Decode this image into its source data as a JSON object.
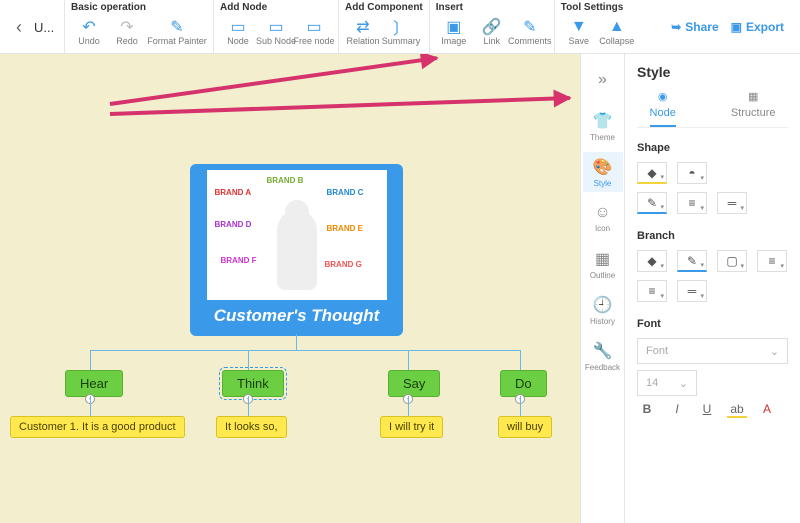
{
  "filename": "U...",
  "toolbar": {
    "groups": [
      {
        "title": "Basic operation",
        "items": [
          {
            "id": "undo",
            "icon": "↶",
            "color": "#3a99e8"
          },
          {
            "id": "redo",
            "icon": "↷",
            "color": "#3a99e8"
          },
          {
            "id": "format-painter",
            "icon": "🖌",
            "color": "#3a99e8",
            "wide": true,
            "label": "Format Painter"
          }
        ],
        "labels": [
          "Undo",
          "Redo",
          "Format Painter"
        ]
      },
      {
        "title": "Add Node",
        "items": [
          {
            "id": "node",
            "icon": "▭"
          },
          {
            "id": "sub-node",
            "icon": "▭"
          },
          {
            "id": "free-node",
            "icon": "▭"
          }
        ],
        "labels": [
          "Node",
          "Sub Node",
          "Free node"
        ]
      },
      {
        "title": "Add Component",
        "items": [
          {
            "id": "relation",
            "icon": "↔"
          },
          {
            "id": "summary",
            "icon": "}"
          }
        ],
        "labels": [
          "Relation",
          "Summary"
        ]
      },
      {
        "title": "Insert",
        "items": [
          {
            "id": "image",
            "icon": "🖼"
          },
          {
            "id": "link",
            "icon": "🔗"
          },
          {
            "id": "comments",
            "icon": "✎"
          }
        ],
        "labels": [
          "Image",
          "Link",
          "Comments"
        ]
      },
      {
        "title": "Tool Settings",
        "items": [
          {
            "id": "save",
            "icon": "💾"
          },
          {
            "id": "collapse",
            "icon": "▲"
          }
        ],
        "labels": [
          "Save",
          "Collapse"
        ]
      }
    ],
    "right": [
      {
        "id": "share",
        "label": "Share",
        "icon": "➥"
      },
      {
        "id": "export",
        "label": "Export",
        "icon": "📁"
      }
    ]
  },
  "vtabs": [
    {
      "id": "expand",
      "icon": "»",
      "label": ""
    },
    {
      "id": "theme",
      "icon": "👕",
      "label": "Theme"
    },
    {
      "id": "style",
      "icon": "🎨",
      "label": "Style",
      "active": true
    },
    {
      "id": "icon",
      "icon": "😊",
      "label": "Icon"
    },
    {
      "id": "outline",
      "icon": "▤",
      "label": "Outline"
    },
    {
      "id": "history",
      "icon": "🕘",
      "label": "History"
    },
    {
      "id": "feedback",
      "icon": "🔧",
      "label": "Feedback"
    }
  ],
  "panel": {
    "title": "Style",
    "tabs": [
      {
        "id": "node",
        "label": "Node",
        "icon": "◉",
        "active": true
      },
      {
        "id": "structure",
        "label": "Structure",
        "icon": "▦"
      }
    ],
    "shape": {
      "title": "Shape"
    },
    "branch": {
      "title": "Branch"
    },
    "font": {
      "title": "Font",
      "family": "Font",
      "size": "14",
      "buttons": [
        "B",
        "I",
        "U",
        "ab",
        "A"
      ]
    }
  },
  "mindmap": {
    "center": {
      "title": "Customer's Thought",
      "brands": [
        "BRAND A",
        "BRAND B",
        "BRAND C",
        "BRAND D",
        "BRAND E",
        "BRAND F",
        "BRAND G"
      ]
    },
    "branches": [
      {
        "name": "Hear",
        "child": "Customer 1. It is a good product"
      },
      {
        "name": "Think",
        "child": "It looks so,"
      },
      {
        "name": "Say",
        "child": "I will try it"
      },
      {
        "name": "Do",
        "child": "will buy"
      }
    ]
  }
}
